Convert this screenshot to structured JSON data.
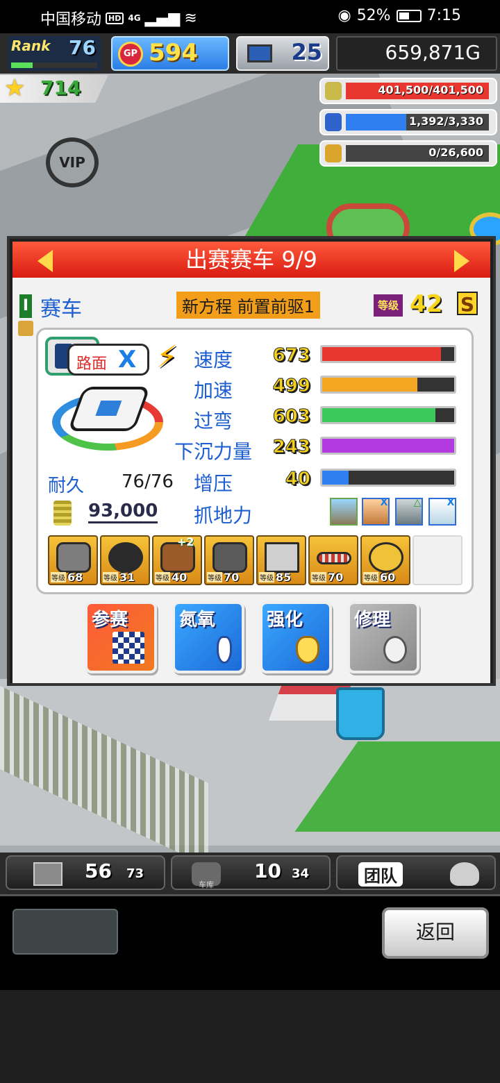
{
  "status_bar": {
    "carrier": "中国移动",
    "hd": "HD",
    "network": "4G",
    "battery": "52%",
    "battery_level": 0.52,
    "time": "7:15"
  },
  "hud": {
    "rank_label": "Rank",
    "rank": "76",
    "rank_progress": 0.25,
    "gp_icon": "GP",
    "gp": "594",
    "computer_count": "25",
    "money": "659,871G",
    "stars": "714"
  },
  "resources": [
    {
      "icon": "coin-stack-icon",
      "text": "401,500/401,500",
      "fill": 1.0,
      "color": "#e8372e"
    },
    {
      "icon": "nitro-bottle-icon",
      "text": "1,392/3,330",
      "fill": 0.42,
      "color": "#2f7ff0"
    },
    {
      "icon": "wheat-icon",
      "text": "0/26,600",
      "fill": 0.0,
      "color": "#8a8a8a"
    }
  ],
  "map": {
    "vip": "VIP"
  },
  "dialog": {
    "title": "出赛赛车 9/9",
    "category": "赛车",
    "car_name": "新方程 前置前驱1",
    "level_tag": "等级",
    "level": "42",
    "grade": "S",
    "terrain_label": "路面",
    "terrain_mark": "X",
    "stats": [
      {
        "label": "速度",
        "value": "673",
        "fill": 0.9,
        "color": "#e8372e"
      },
      {
        "label": "加速",
        "value": "499",
        "fill": 0.72,
        "color": "#f5a623"
      },
      {
        "label": "过弯",
        "value": "603",
        "fill": 0.86,
        "color": "#3cc85a"
      },
      {
        "label": "下沉力量",
        "value": "243",
        "fill": 1.0,
        "color": "#b23ae0"
      },
      {
        "label": "增压",
        "value": "40",
        "fill": 0.2,
        "color": "#2f7ff0"
      }
    ],
    "durability_label": "耐久",
    "durability": "76/76",
    "price": "93,000",
    "grip_label": "抓地力",
    "grip_icons": [
      "grip-sun-icon",
      "grip-x-icon",
      "grip-triangle-icon",
      "grip-x-icon"
    ],
    "grip_marks": [
      "",
      "X",
      "△",
      "X"
    ],
    "parts": [
      {
        "name": "engine-part-icon",
        "tag": "等级",
        "level": "68",
        "plus": ""
      },
      {
        "name": "tire-part-icon",
        "tag": "等级",
        "level": "31",
        "plus": ""
      },
      {
        "name": "suspension-part-icon",
        "tag": "等级",
        "level": "40",
        "plus": "+2"
      },
      {
        "name": "turbo-part-icon",
        "tag": "等级",
        "level": "70",
        "plus": ""
      },
      {
        "name": "wing-part-icon",
        "tag": "等级",
        "level": "85",
        "plus": ""
      },
      {
        "name": "exhaust-part-icon",
        "tag": "等级",
        "level": "70",
        "plus": ""
      },
      {
        "name": "brake-part-icon",
        "tag": "等级",
        "level": "60",
        "plus": ""
      }
    ],
    "actions": {
      "race": "参赛",
      "nitro": "氮氧",
      "boost": "强化",
      "repair": "修理"
    }
  },
  "bottom_bar": {
    "items_count": "56",
    "items_total": "73",
    "garage_label": "车库",
    "garage_count": "10",
    "garage_total": "34",
    "team_label": "团队"
  },
  "footer": {
    "back": "返回"
  }
}
